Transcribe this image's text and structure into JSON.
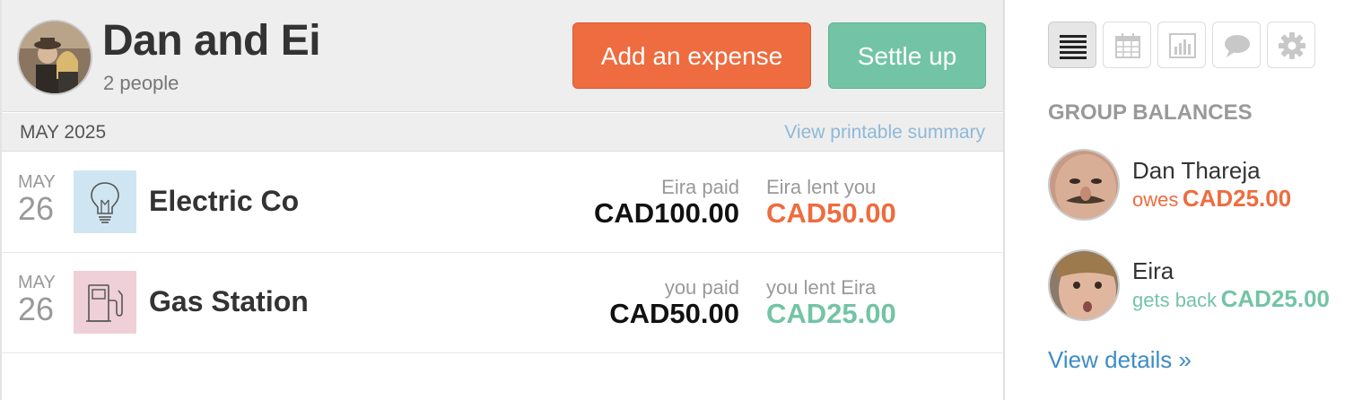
{
  "header": {
    "group_name": "Dan and Ei",
    "member_count": "2 people",
    "add_expense_label": "Add an expense",
    "settle_up_label": "Settle up"
  },
  "month_bar": {
    "label": "MAY 2025",
    "printable_link": "View printable summary"
  },
  "expenses": [
    {
      "month": "MAY",
      "day": "26",
      "name": "Electric Co",
      "icon": "lightbulb-icon",
      "paid_label": "Eira paid",
      "paid_amount": "CAD100.00",
      "lent_label": "Eira lent you",
      "lent_amount": "CAD50.00",
      "lent_color": "#ee6c3f"
    },
    {
      "month": "MAY",
      "day": "26",
      "name": "Gas Station",
      "icon": "gas-pump-icon",
      "paid_label": "you paid",
      "paid_amount": "CAD50.00",
      "lent_label": "you lent Eira",
      "lent_amount": "CAD25.00",
      "lent_color": "#73c4a6"
    }
  ],
  "sidebar": {
    "toolbar": [
      "list-view-icon",
      "calendar-icon",
      "chart-icon",
      "chat-icon",
      "settings-gear-icon"
    ],
    "balances_title": "GROUP BALANCES",
    "members": [
      {
        "name": "Dan Thareja",
        "verb": "owes",
        "amount": "CAD25.00",
        "color": "#ee6c3f"
      },
      {
        "name": "Eira",
        "verb": "gets back",
        "amount": "CAD25.00",
        "color": "#73c4a6"
      }
    ],
    "details_link": "View details »"
  },
  "colors": {
    "orange": "#ee6c3f",
    "teal": "#73c4a6",
    "link_blue": "#3d8cc6"
  }
}
